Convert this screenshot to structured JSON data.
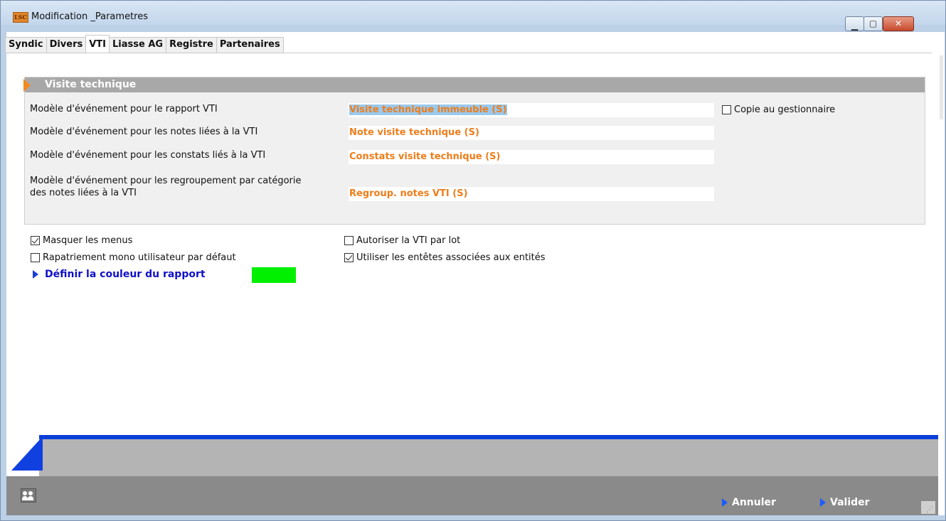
{
  "window": {
    "logo": "LSC",
    "title": "Modification _Parametres",
    "min_glyph": "▁",
    "max_glyph": "▢",
    "close_glyph": "✕"
  },
  "tabs": [
    {
      "label": "Syndic",
      "active": false
    },
    {
      "label": "Divers",
      "active": false
    },
    {
      "label": "VTI",
      "active": true
    },
    {
      "label": "Liasse AG",
      "active": false
    },
    {
      "label": "Registre",
      "active": false
    },
    {
      "label": "Partenaires",
      "active": false
    }
  ],
  "section": {
    "title": "Visite technique",
    "rows": [
      {
        "label": "Modèle d'événement pour le rapport VTI",
        "value": "Visite technique immeuble (S)"
      },
      {
        "label": "Modèle d'événement pour les notes liées à la VTI",
        "value": "Note visite technique (S)"
      },
      {
        "label": "Modèle d'événement pour les constats liés à la VTI",
        "value": "Constats visite technique (S)"
      },
      {
        "label_line1": "Modèle d'événement pour les regroupement par catégorie",
        "label_line2": "des notes liées à la VTI",
        "value": "Regroup. notes VTI (S)"
      }
    ],
    "copie_gestionnaire": {
      "label": "Copie au gestionnaire",
      "checked": false
    }
  },
  "options": {
    "masquer_menus": {
      "label": "Masquer les menus",
      "checked": true
    },
    "rapatriement": {
      "label": "Rapatriement mono utilisateur par défaut",
      "checked": false
    },
    "autoriser_vti_lot": {
      "label": "Autoriser la VTI par lot",
      "checked": false
    },
    "utiliser_entetes": {
      "label": "Utiliser les entêtes associées aux entités",
      "checked": true
    }
  },
  "couleur_rapport": {
    "label": "Définir la couleur du rapport",
    "color": "#00f000"
  },
  "footer": {
    "annuler": "Annuler",
    "valider": "Valider",
    "icon": "users-icon"
  },
  "colors": {
    "accent_orange": "#ef7d1a",
    "link_blue": "#1010c8",
    "footer_gray": "#8a8a8a",
    "section_header": "#a8a8a8"
  }
}
